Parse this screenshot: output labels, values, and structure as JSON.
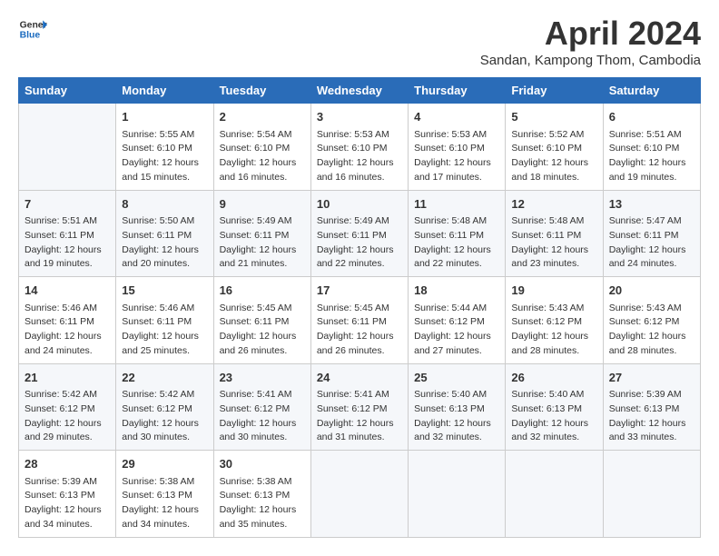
{
  "header": {
    "logo_line1": "General",
    "logo_line2": "Blue",
    "month_title": "April 2024",
    "subtitle": "Sandan, Kampong Thom, Cambodia"
  },
  "days_of_week": [
    "Sunday",
    "Monday",
    "Tuesday",
    "Wednesday",
    "Thursday",
    "Friday",
    "Saturday"
  ],
  "weeks": [
    [
      {
        "day": "",
        "info": ""
      },
      {
        "day": "1",
        "info": "Sunrise: 5:55 AM\nSunset: 6:10 PM\nDaylight: 12 hours\nand 15 minutes."
      },
      {
        "day": "2",
        "info": "Sunrise: 5:54 AM\nSunset: 6:10 PM\nDaylight: 12 hours\nand 16 minutes."
      },
      {
        "day": "3",
        "info": "Sunrise: 5:53 AM\nSunset: 6:10 PM\nDaylight: 12 hours\nand 16 minutes."
      },
      {
        "day": "4",
        "info": "Sunrise: 5:53 AM\nSunset: 6:10 PM\nDaylight: 12 hours\nand 17 minutes."
      },
      {
        "day": "5",
        "info": "Sunrise: 5:52 AM\nSunset: 6:10 PM\nDaylight: 12 hours\nand 18 minutes."
      },
      {
        "day": "6",
        "info": "Sunrise: 5:51 AM\nSunset: 6:10 PM\nDaylight: 12 hours\nand 19 minutes."
      }
    ],
    [
      {
        "day": "7",
        "info": "Sunrise: 5:51 AM\nSunset: 6:11 PM\nDaylight: 12 hours\nand 19 minutes."
      },
      {
        "day": "8",
        "info": "Sunrise: 5:50 AM\nSunset: 6:11 PM\nDaylight: 12 hours\nand 20 minutes."
      },
      {
        "day": "9",
        "info": "Sunrise: 5:49 AM\nSunset: 6:11 PM\nDaylight: 12 hours\nand 21 minutes."
      },
      {
        "day": "10",
        "info": "Sunrise: 5:49 AM\nSunset: 6:11 PM\nDaylight: 12 hours\nand 22 minutes."
      },
      {
        "day": "11",
        "info": "Sunrise: 5:48 AM\nSunset: 6:11 PM\nDaylight: 12 hours\nand 22 minutes."
      },
      {
        "day": "12",
        "info": "Sunrise: 5:48 AM\nSunset: 6:11 PM\nDaylight: 12 hours\nand 23 minutes."
      },
      {
        "day": "13",
        "info": "Sunrise: 5:47 AM\nSunset: 6:11 PM\nDaylight: 12 hours\nand 24 minutes."
      }
    ],
    [
      {
        "day": "14",
        "info": "Sunrise: 5:46 AM\nSunset: 6:11 PM\nDaylight: 12 hours\nand 24 minutes."
      },
      {
        "day": "15",
        "info": "Sunrise: 5:46 AM\nSunset: 6:11 PM\nDaylight: 12 hours\nand 25 minutes."
      },
      {
        "day": "16",
        "info": "Sunrise: 5:45 AM\nSunset: 6:11 PM\nDaylight: 12 hours\nand 26 minutes."
      },
      {
        "day": "17",
        "info": "Sunrise: 5:45 AM\nSunset: 6:11 PM\nDaylight: 12 hours\nand 26 minutes."
      },
      {
        "day": "18",
        "info": "Sunrise: 5:44 AM\nSunset: 6:12 PM\nDaylight: 12 hours\nand 27 minutes."
      },
      {
        "day": "19",
        "info": "Sunrise: 5:43 AM\nSunset: 6:12 PM\nDaylight: 12 hours\nand 28 minutes."
      },
      {
        "day": "20",
        "info": "Sunrise: 5:43 AM\nSunset: 6:12 PM\nDaylight: 12 hours\nand 28 minutes."
      }
    ],
    [
      {
        "day": "21",
        "info": "Sunrise: 5:42 AM\nSunset: 6:12 PM\nDaylight: 12 hours\nand 29 minutes."
      },
      {
        "day": "22",
        "info": "Sunrise: 5:42 AM\nSunset: 6:12 PM\nDaylight: 12 hours\nand 30 minutes."
      },
      {
        "day": "23",
        "info": "Sunrise: 5:41 AM\nSunset: 6:12 PM\nDaylight: 12 hours\nand 30 minutes."
      },
      {
        "day": "24",
        "info": "Sunrise: 5:41 AM\nSunset: 6:12 PM\nDaylight: 12 hours\nand 31 minutes."
      },
      {
        "day": "25",
        "info": "Sunrise: 5:40 AM\nSunset: 6:13 PM\nDaylight: 12 hours\nand 32 minutes."
      },
      {
        "day": "26",
        "info": "Sunrise: 5:40 AM\nSunset: 6:13 PM\nDaylight: 12 hours\nand 32 minutes."
      },
      {
        "day": "27",
        "info": "Sunrise: 5:39 AM\nSunset: 6:13 PM\nDaylight: 12 hours\nand 33 minutes."
      }
    ],
    [
      {
        "day": "28",
        "info": "Sunrise: 5:39 AM\nSunset: 6:13 PM\nDaylight: 12 hours\nand 34 minutes."
      },
      {
        "day": "29",
        "info": "Sunrise: 5:38 AM\nSunset: 6:13 PM\nDaylight: 12 hours\nand 34 minutes."
      },
      {
        "day": "30",
        "info": "Sunrise: 5:38 AM\nSunset: 6:13 PM\nDaylight: 12 hours\nand 35 minutes."
      },
      {
        "day": "",
        "info": ""
      },
      {
        "day": "",
        "info": ""
      },
      {
        "day": "",
        "info": ""
      },
      {
        "day": "",
        "info": ""
      }
    ]
  ]
}
